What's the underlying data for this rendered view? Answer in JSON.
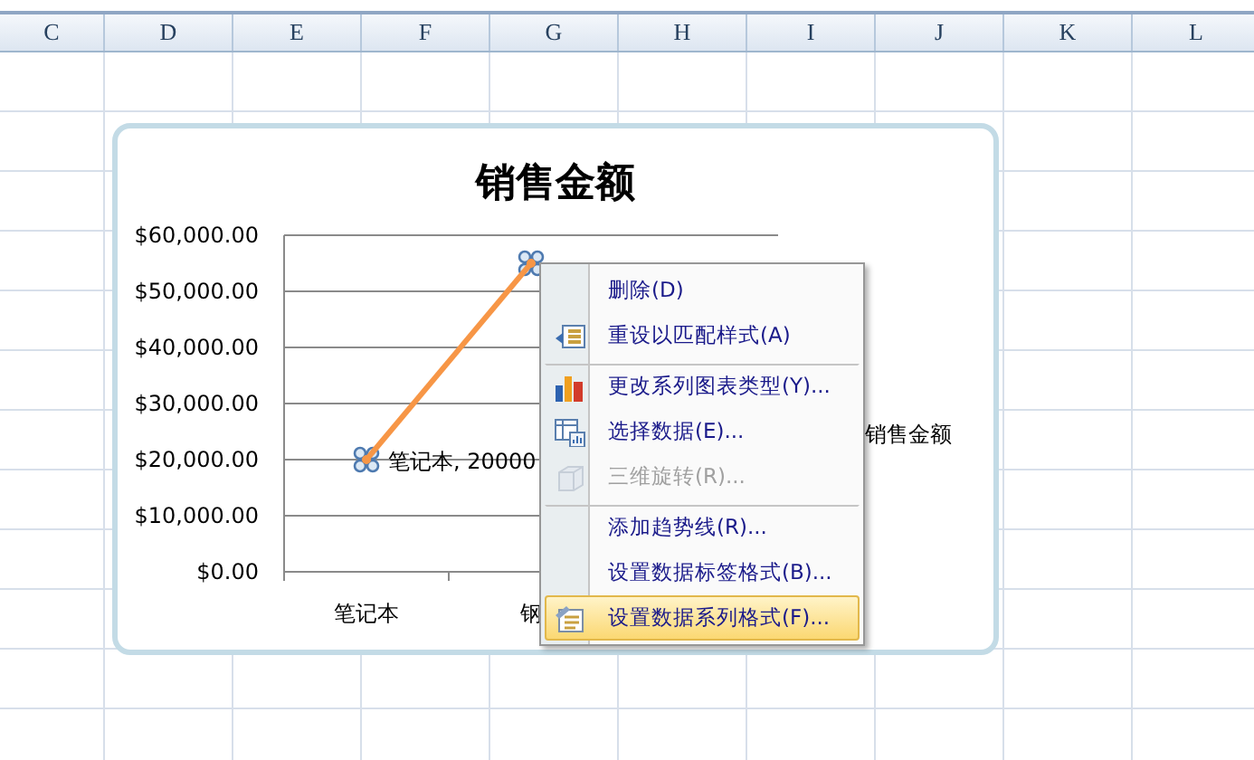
{
  "columns": [
    "C",
    "D",
    "E",
    "F",
    "G",
    "H",
    "I",
    "J",
    "K",
    "L"
  ],
  "chart": {
    "chart_data": {
      "type": "line",
      "title": "销售金额",
      "categories": [
        "笔记本",
        "钢"
      ],
      "series": [
        {
          "name": "销售金额",
          "color": "#f79646",
          "values": [
            20000,
            55000
          ],
          "marker": "circle"
        }
      ],
      "ylim": [
        0,
        60000
      ],
      "yticks": [
        {
          "value": 0,
          "label": "$0.00"
        },
        {
          "value": 10000,
          "label": "$10,000.00"
        },
        {
          "value": 20000,
          "label": "$20,000.00"
        },
        {
          "value": 30000,
          "label": "$30,000.00"
        },
        {
          "value": 40000,
          "label": "$40,000.00"
        },
        {
          "value": 50000,
          "label": "$50,000.00"
        },
        {
          "value": 60000,
          "label": "$60,000.00"
        }
      ],
      "grid": true,
      "value_labels": [
        "笔记本, 20000",
        null
      ]
    }
  },
  "context_menu": [
    {
      "label": "删除(D)",
      "separator_before": false,
      "disabled": false,
      "selected": false
    },
    {
      "label": "重设以匹配样式(A)",
      "separator_before": false,
      "disabled": false,
      "selected": false
    },
    {
      "label": "更改系列图表类型(Y)...",
      "separator_before": true,
      "disabled": false,
      "selected": false
    },
    {
      "label": "选择数据(E)...",
      "separator_before": false,
      "disabled": false,
      "selected": false
    },
    {
      "label": "三维旋转(R)...",
      "separator_before": false,
      "disabled": true,
      "selected": false
    },
    {
      "label": "添加趋势线(R)...",
      "separator_before": true,
      "disabled": false,
      "selected": false
    },
    {
      "label": "设置数据标签格式(B)...",
      "separator_before": false,
      "disabled": false,
      "selected": false
    },
    {
      "label": "设置数据系列格式(F)...",
      "separator_before": false,
      "disabled": false,
      "selected": true
    }
  ]
}
